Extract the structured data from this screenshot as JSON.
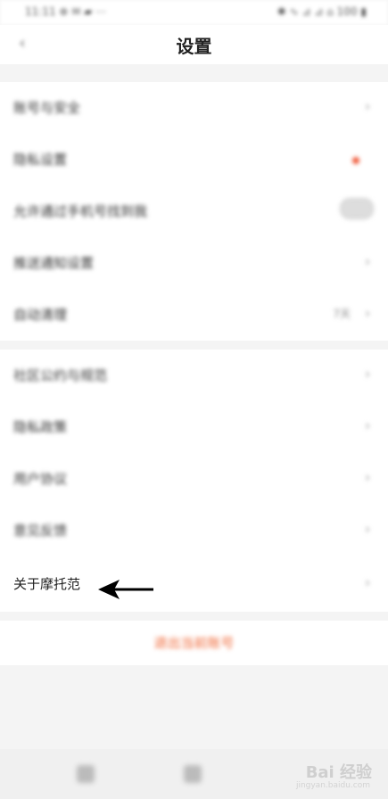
{
  "status_bar": {
    "left_text": "11:11 ⊕ ✉ ▰ ⋯",
    "right_text": "✱ ∿ ⊿ ⊿ ⌂ 100 ▮"
  },
  "header": {
    "title": "设置",
    "back_icon": "chevron-left-icon"
  },
  "settings_group_1": [
    {
      "label": "账号与安全",
      "type": "chevron"
    },
    {
      "label": "隐私设置",
      "type": "dot"
    },
    {
      "label": "允许通过手机号找到我",
      "type": "toggle"
    },
    {
      "label": "推送通知设置",
      "type": "chevron"
    },
    {
      "label": "自动清理",
      "type": "value",
      "value": "7天"
    }
  ],
  "settings_group_2": [
    {
      "label": "社区公约与规范",
      "type": "chevron"
    },
    {
      "label": "隐私政策",
      "type": "chevron"
    },
    {
      "label": "用户协议",
      "type": "chevron"
    },
    {
      "label": "意见反馈",
      "type": "chevron"
    },
    {
      "label": "关于摩托范",
      "type": "chevron"
    }
  ],
  "logout": {
    "label": "退出当前账号"
  },
  "watermark": {
    "text": "Bai 经验",
    "sub": "jingyan.baidu.com"
  },
  "colors": {
    "accent": "#f06a3a",
    "dot": "#f05a3a"
  }
}
